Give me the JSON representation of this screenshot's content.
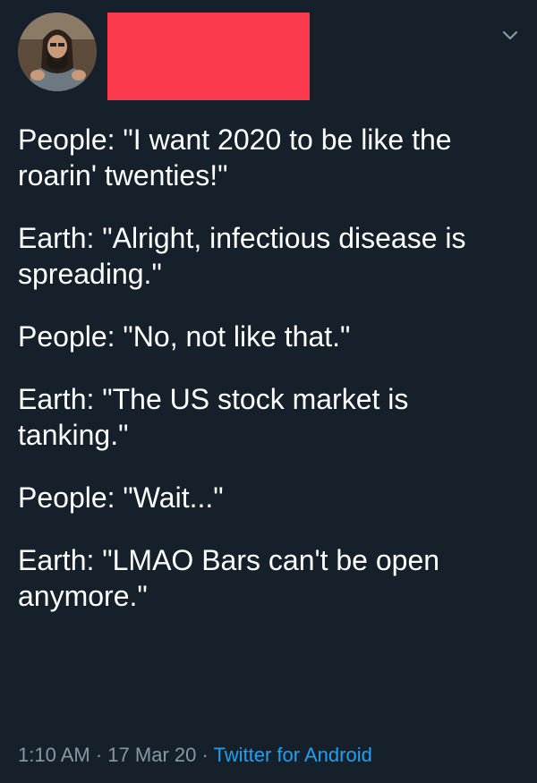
{
  "tweet": {
    "paragraphs": [
      "People: \"I want 2020 to be like the roarin' twenties!\"",
      "Earth: \"Alright, infectious disease is spreading.\"",
      "People: \"No, not like that.\"",
      "Earth: \"The US stock market is tanking.\"",
      "People: \"Wait...\"",
      "Earth: \"LMAO Bars can't be open anymore.\""
    ],
    "time": "1:10 AM",
    "date": "17 Mar 20",
    "separator": "·",
    "source": "Twitter for Android"
  },
  "icons": {
    "menu": "chevron-down-icon"
  },
  "colors": {
    "background": "#15202b",
    "text": "#ffffff",
    "muted": "#8899a6",
    "link": "#1da1f2",
    "redaction": "#fc3a4d"
  }
}
